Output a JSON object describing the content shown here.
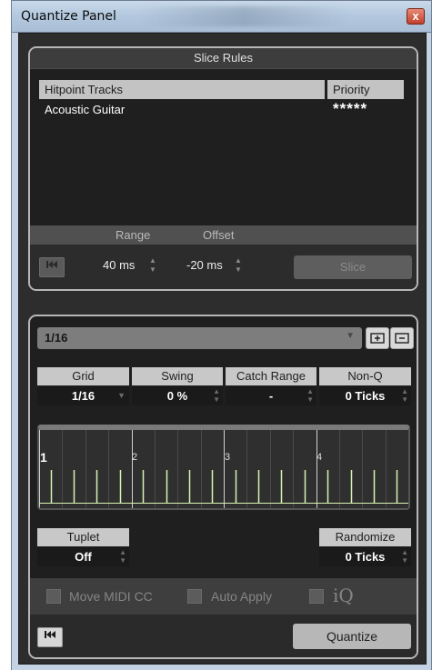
{
  "window": {
    "title": "Quantize Panel",
    "close_glyph": "x"
  },
  "slice_rules": {
    "title": "Slice Rules",
    "columns": {
      "tracks": "Hitpoint Tracks",
      "priority": "Priority"
    },
    "rows": [
      {
        "track": "Acoustic Guitar",
        "priority": "*****"
      }
    ],
    "range_label": "Range",
    "offset_label": "Offset",
    "range_value": "40 ms",
    "offset_value": "-20 ms",
    "slice_button": "Slice",
    "prev_icon": "skip-to-start-icon"
  },
  "quantize": {
    "preset": "1/16",
    "params": [
      {
        "label": "Grid",
        "value": "1/16"
      },
      {
        "label": "Swing",
        "value": "0 %"
      },
      {
        "label": "Catch Range",
        "value": "-"
      },
      {
        "label": "Non-Q",
        "value": "0 Ticks"
      }
    ],
    "grid_bars": [
      "1",
      "2",
      "3",
      "4"
    ],
    "tuplet": {
      "label": "Tuplet",
      "value": "Off"
    },
    "randomize": {
      "label": "Randomize",
      "value": "0 Ticks"
    },
    "options": {
      "move_midi_cc": "Move MIDI CC",
      "auto_apply": "Auto Apply",
      "iq": "iQ"
    },
    "quantize_button": "Quantize",
    "colors": {
      "grid_line": "#d9f2b3",
      "panel_border": "#b7b7b7"
    }
  }
}
